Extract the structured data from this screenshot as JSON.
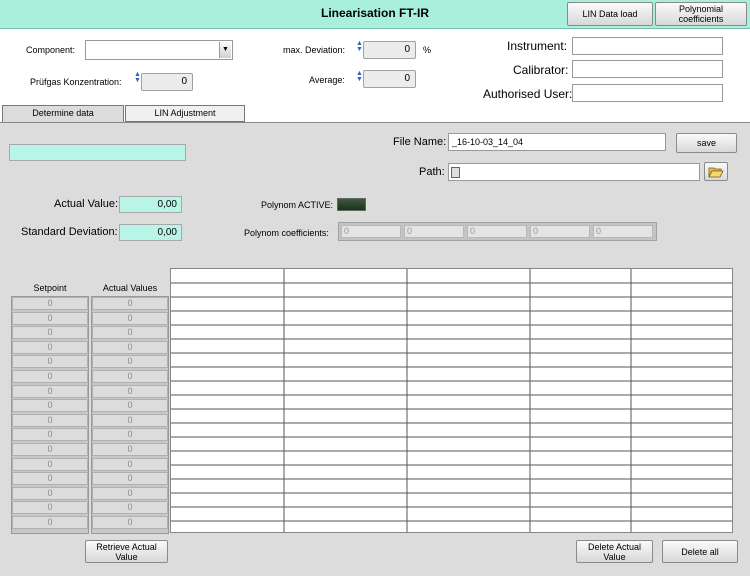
{
  "window": {
    "title": "Linearisation FT-IR"
  },
  "header_buttons": {
    "lin_data_load": "LIN Data load",
    "polynomial_coefficients": "Polynomial coefficients"
  },
  "form": {
    "component_label": "Component:",
    "component_value": "",
    "pruefgas_label": "Prüfgas Konzentration:",
    "pruefgas_value": "0",
    "max_deviation_label": "max. Deviation:",
    "max_deviation_value": "0",
    "max_deviation_unit": "%",
    "average_label": "Average:",
    "average_value": "0",
    "instrument_label": "Instrument:",
    "instrument_value": "",
    "calibrator_label": "Calibrator:",
    "calibrator_value": "",
    "authorised_label": "Authorised User:",
    "authorised_value": ""
  },
  "tabs": [
    {
      "label": "Determine data",
      "active": true
    },
    {
      "label": "LIN Adjustment",
      "active": false
    }
  ],
  "determine": {
    "status_value": "",
    "file_name_label": "File Name:",
    "file_name_value": "_16-10-03_14_04",
    "save_label": "save",
    "path_label": "Path:",
    "path_value": "",
    "actual_value_label": "Actual Value:",
    "actual_value": "0,00",
    "std_dev_label": "Standard Deviation:",
    "std_dev_value": "0,00",
    "polynom_active_label": "Polynom ACTIVE:",
    "polynom_coeffs_label": "Polynom coefficients:",
    "polynom_coeffs": [
      "0",
      "0",
      "0",
      "0",
      "0"
    ]
  },
  "table": {
    "setpoint_header": "Setpoint",
    "actual_header": "Actual Values",
    "setpoints": [
      "0",
      "0",
      "0",
      "0",
      "0",
      "0",
      "0",
      "0",
      "0",
      "0",
      "0",
      "0",
      "0",
      "0",
      "0",
      "0"
    ],
    "actuals": [
      "0",
      "0",
      "0",
      "0",
      "0",
      "0",
      "0",
      "0",
      "0",
      "0",
      "0",
      "0",
      "0",
      "0",
      "0",
      "0"
    ]
  },
  "bottom_buttons": {
    "retrieve": "Retrieve Actual Value",
    "delete_actual": "Delete Actual Value",
    "delete_all": "Delete all"
  },
  "colors": {
    "title_bg": "#a8f0dc",
    "cyan_field": "#b8f5e6",
    "panel_bg": "#dcdcdc",
    "led_off": "#2c4a2c"
  }
}
